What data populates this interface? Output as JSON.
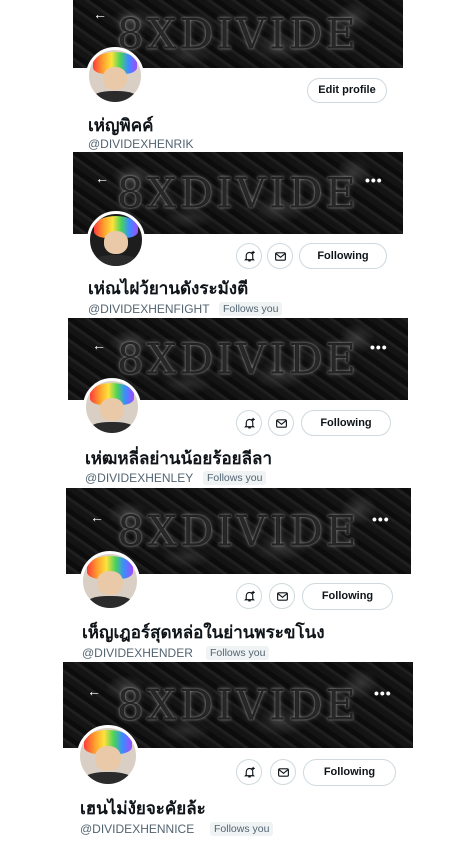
{
  "banner_text": "8XDIVIDE",
  "icons": {
    "back": "←",
    "more": "•••",
    "notify": "bell-plus-icon",
    "message": "mail-icon"
  },
  "colors": {
    "banner_bg": "#111111",
    "text": "#0f1419",
    "muted": "#536471",
    "chip_bg": "#eff3f4",
    "border": "#cfd9de"
  },
  "profiles": [
    {
      "display_name": "เห่ญพิคค์",
      "handle": "@DIVIDEXHENRIK",
      "action_label": "Edit profile",
      "follows_you": ""
    },
    {
      "display_name": "เห่ณไฝว้ยานดังระมังตี",
      "handle": "@DIVIDEXHENFIGHT",
      "action_label": "Following",
      "follows_you": "Follows you"
    },
    {
      "display_name": "เห่ฒหลี่ลย่านน้อยร้อยลีลา",
      "handle": "@DIVIDEXHENLEY",
      "action_label": "Following",
      "follows_you": "Follows you"
    },
    {
      "display_name": "เห็ญเฎอร์สุดหล่อในย่านพระขโนง",
      "handle": "@DIVIDEXHENDER",
      "action_label": "Following",
      "follows_you": "Follows you"
    },
    {
      "display_name": "เฮนไม่งัยจะคัยล้ะ",
      "handle": "@DIVIDEXHENNICE",
      "action_label": "Following",
      "follows_you": "Follows you"
    }
  ]
}
